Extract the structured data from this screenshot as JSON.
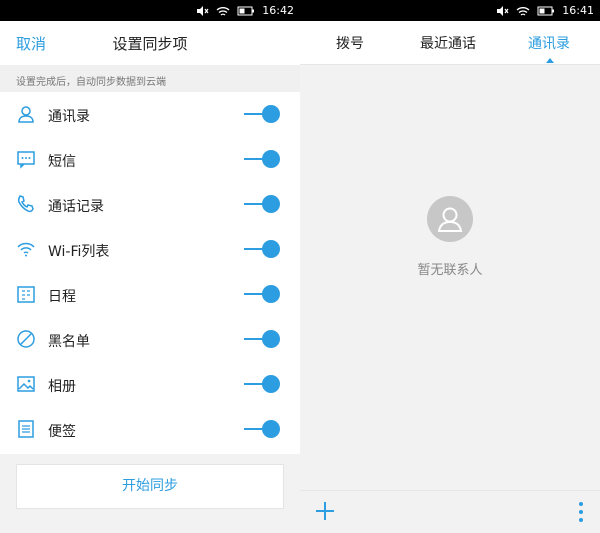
{
  "left_screen": {
    "status_time": "16:42",
    "cancel_label": "取消",
    "title": "设置同步项",
    "hint": "设置完成后，自动同步数据到云端",
    "items": [
      {
        "label": "通讯录",
        "icon": "contacts-icon",
        "enabled": true
      },
      {
        "label": "短信",
        "icon": "sms-icon",
        "enabled": true
      },
      {
        "label": "通话记录",
        "icon": "phone-icon",
        "enabled": true
      },
      {
        "label": "Wi-Fi列表",
        "icon": "wifi-icon",
        "enabled": true
      },
      {
        "label": "日程",
        "icon": "calendar-icon",
        "enabled": true
      },
      {
        "label": "黑名单",
        "icon": "blocked-icon",
        "enabled": true
      },
      {
        "label": "相册",
        "icon": "gallery-icon",
        "enabled": true
      },
      {
        "label": "便签",
        "icon": "notes-icon",
        "enabled": true
      }
    ],
    "sync_button": "开始同步"
  },
  "right_screen": {
    "status_time": "16:41",
    "tabs": [
      {
        "label": "拨号",
        "active": false
      },
      {
        "label": "最近通话",
        "active": false
      },
      {
        "label": "通讯录",
        "active": true
      }
    ],
    "empty_text": "暂无联系人"
  },
  "colors": {
    "accent": "#2c9de0",
    "bg": "#f2f2f2"
  }
}
